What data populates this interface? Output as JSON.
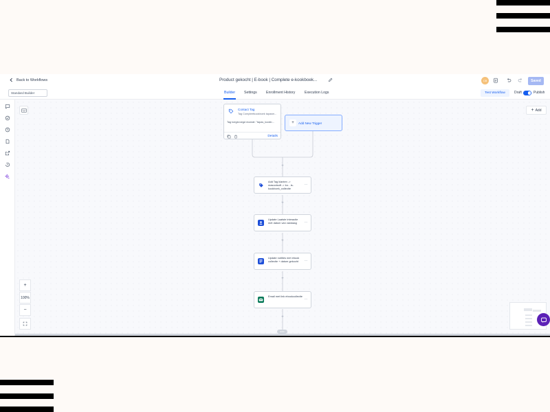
{
  "header": {
    "back_label": "Back to Workflows",
    "title": "Product gekocht | E-book | Complete e-kookboek...",
    "avatar_initials": "CB",
    "saved_label": "Saved"
  },
  "tabbar": {
    "builder_select": "Standard Builder",
    "tabs": [
      {
        "label": "Builder",
        "active": true
      },
      {
        "label": "Settings"
      },
      {
        "label": "Enrollment History"
      },
      {
        "label": "Execution Logs"
      }
    ],
    "test_workflow_label": "Test Workflow",
    "draft_label": "Draft",
    "publish_label": "Publish"
  },
  "canvas": {
    "add_label": "Add",
    "trigger": {
      "title": "Contact Tag",
      "subtitle": "Tag Compleetkookboek tapasm...",
      "description": "Tag toegevoegd module: \"tapas_kookb...",
      "details_label": "Details"
    },
    "add_trigger_label": "Add New Trigger",
    "actions": [
      {
        "label": "Add Tag klanten -> masootsoft -> ko…is-kookboek_collectie",
        "icon": "tag-icon",
        "color": "#1d4ed8"
      },
      {
        "label": "Update Laatste interactie met datum van vandaag",
        "icon": "user-icon",
        "color": "#1d4ed8"
      },
      {
        "label": "Update notities met ebook collectie + datum gekocht",
        "icon": "note-icon",
        "color": "#1d4ed8"
      },
      {
        "label": "Email met link ebookcollectie",
        "icon": "email-icon",
        "color": "#047857"
      }
    ],
    "end_label": "END",
    "zoom_level": "100%"
  },
  "colors": {
    "accent": "#155eef",
    "saved_button": "#a5b8f3",
    "help_button": "#5b21b6"
  }
}
